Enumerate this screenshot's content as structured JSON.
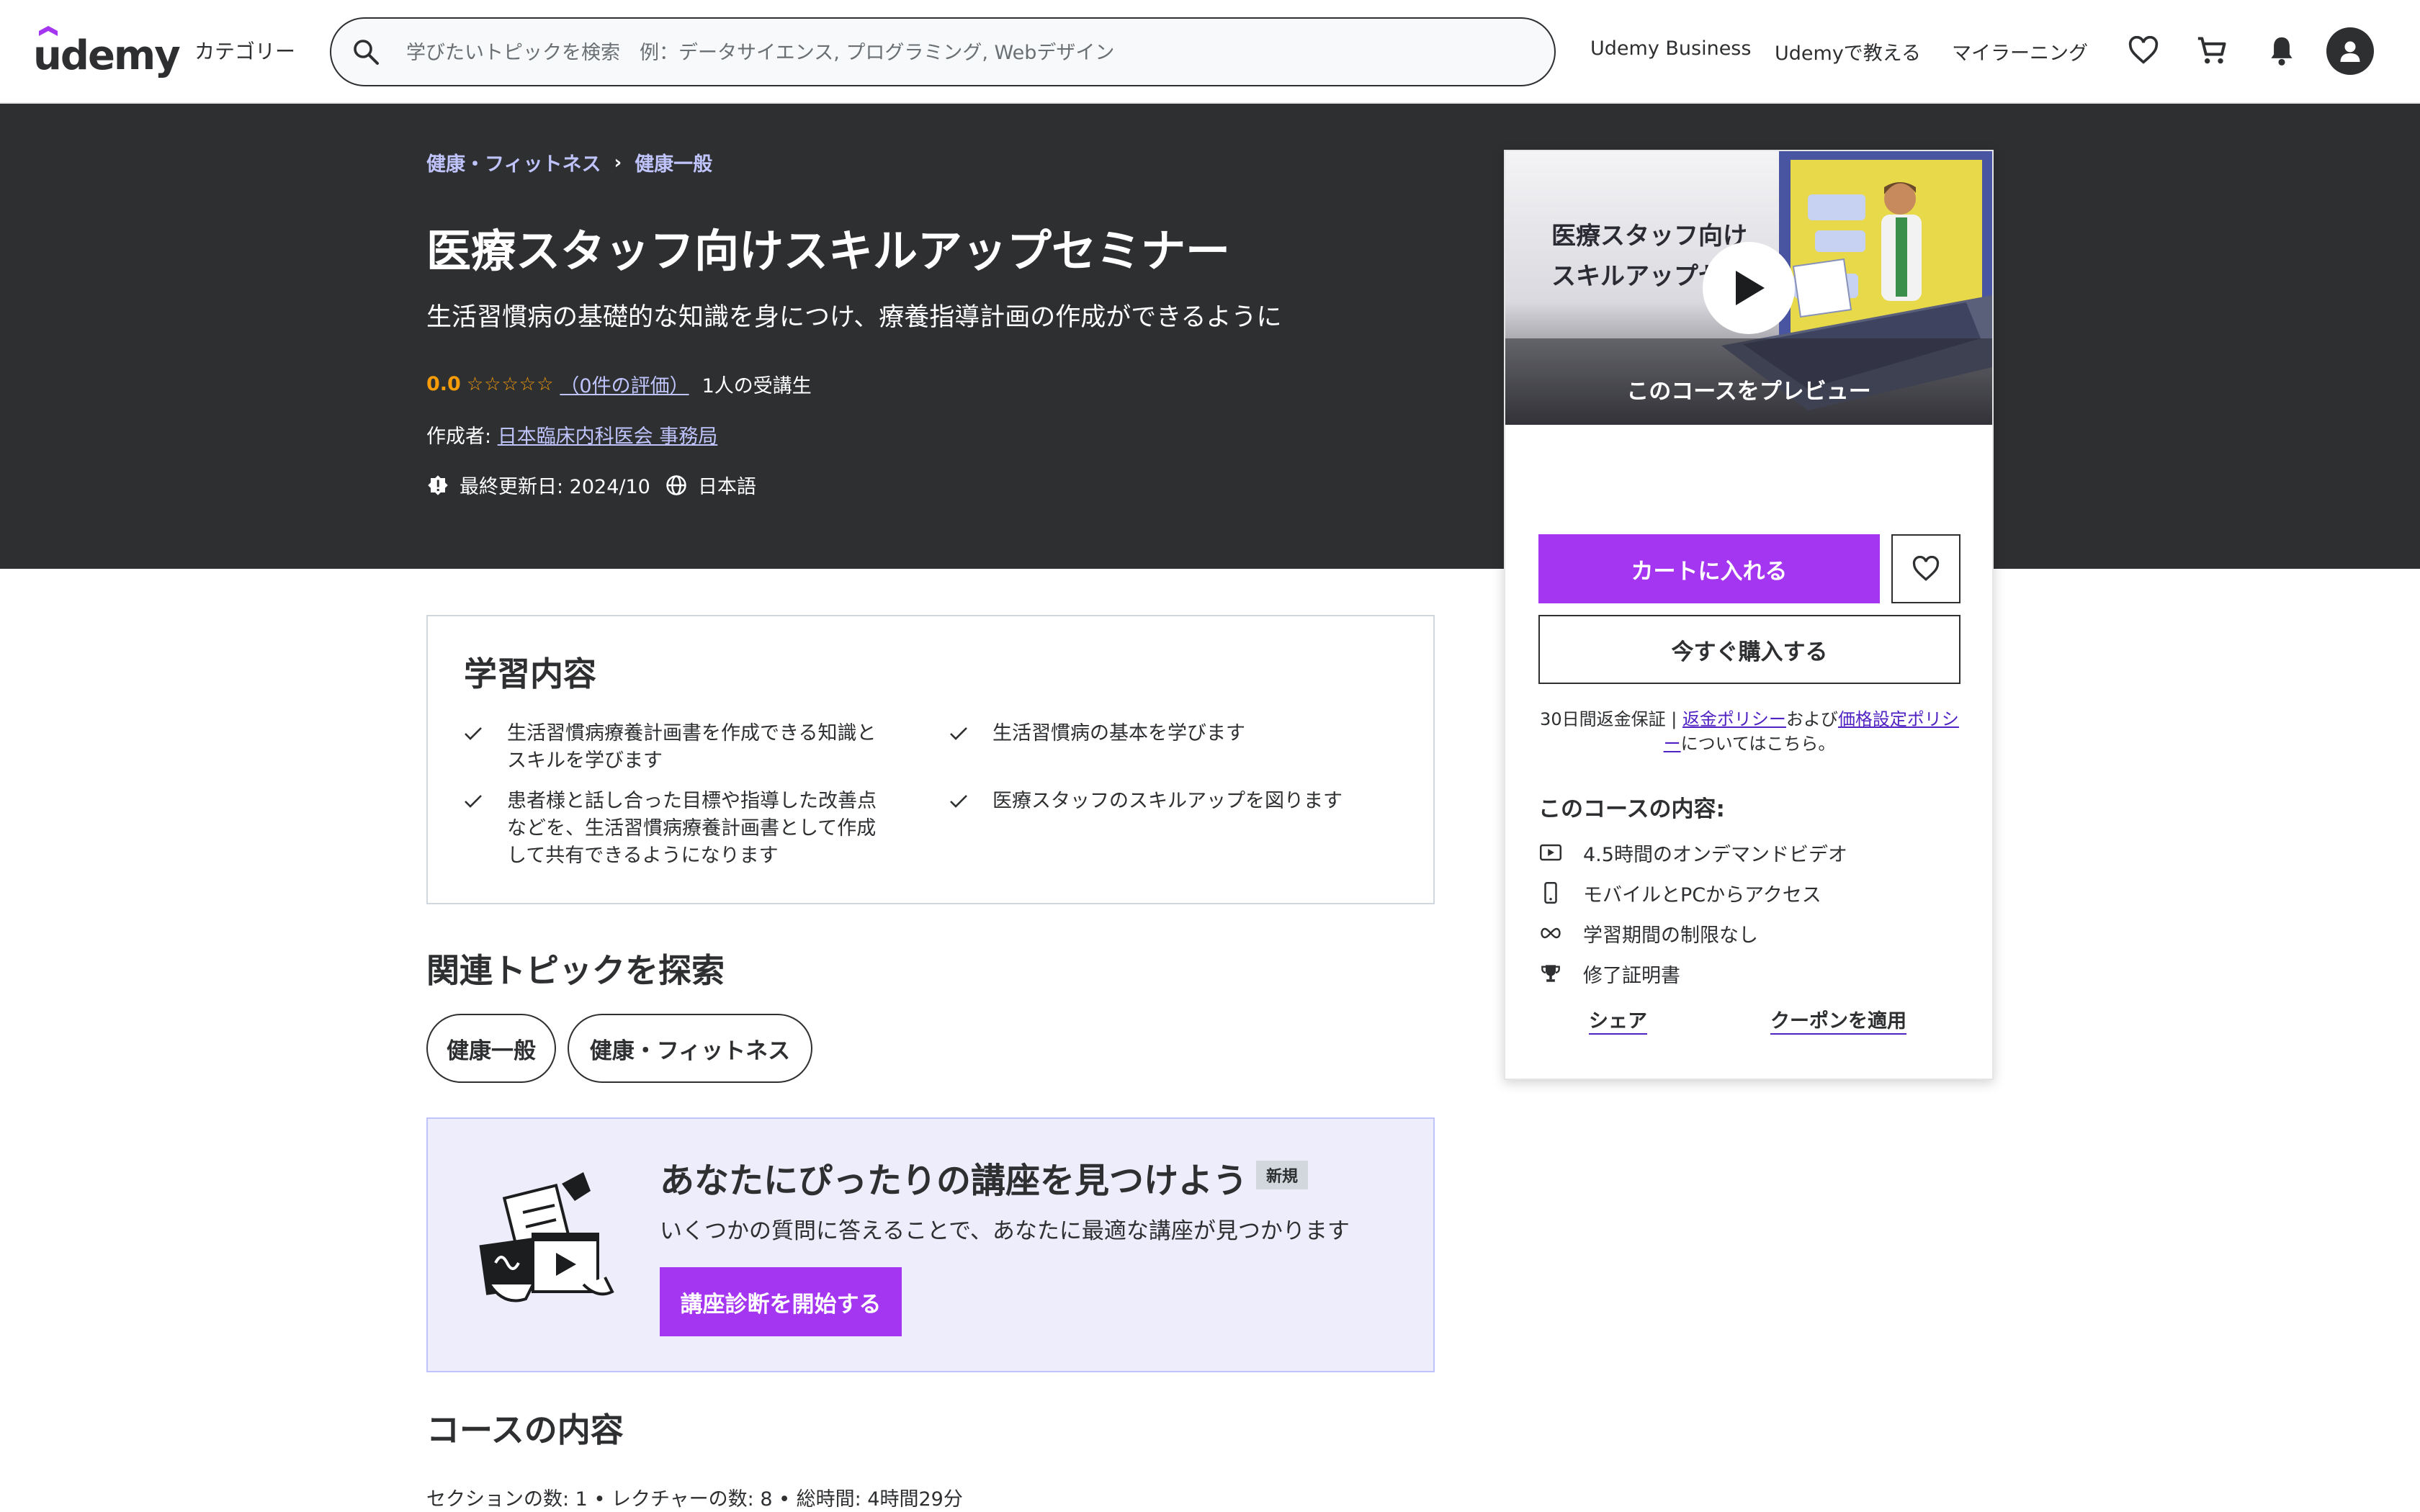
{
  "header": {
    "logo_text": "udemy",
    "categories_label": "カテゴリー",
    "search_placeholder": "学びたいトピックを検索　例：データサイエンス, プログラミング, Webデザイン",
    "nav": {
      "business": "Udemy Business",
      "teach": "Udemyで教える",
      "my_learning": "マイラーニング"
    }
  },
  "course": {
    "breadcrumb": [
      "健康・フィットネス",
      "健康一般"
    ],
    "title": "医療スタッフ向けスキルアップセミナー",
    "subtitle": "生活習慣病の基礎的な知識を身につけ、療養指導計画の作成ができるように",
    "rating_value": "0.0",
    "stars": "☆☆☆☆☆",
    "rating_count": "（0件の評価）",
    "students": "1人の受講生",
    "author_label": "作成者: ",
    "author": "日本臨床内科医会 事務局",
    "last_updated": "最終更新日: 2024/10",
    "language": "日本語"
  },
  "sidebar": {
    "preview_line1": "医療スタッフ向け",
    "preview_line2": "スキルアップセ",
    "preview_label": "このコースをプレビュー",
    "add_to_cart": "カートに入れる",
    "buy_now": "今すぐ購入する",
    "guarantee_pre": "30日間返金保証 | ",
    "refund_link": "返金ポリシー",
    "guarantee_mid": "および",
    "pricing_link": "価格設定ポリシー",
    "guarantee_post": "についてはこちら。",
    "includes_title": "このコースの内容:",
    "includes": [
      {
        "icon": "video-icon",
        "text": "4.5時間のオンデマンドビデオ"
      },
      {
        "icon": "mobile-icon",
        "text": "モバイルとPCからアクセス"
      },
      {
        "icon": "infinity-icon",
        "text": "学習期間の制限なし"
      },
      {
        "icon": "trophy-icon",
        "text": "修了証明書"
      }
    ],
    "share": "シェア",
    "coupon": "クーポンを適用"
  },
  "learn": {
    "title": "学習内容",
    "items": [
      "生活習慣病療養計画書を作成できる知識とスキルを学びます",
      "生活習慣病の基本を学びます",
      "患者様と話し合った目標や指導した改善点などを、生活習慣病療養計画書として作成して共有できるようになります",
      "医療スタッフのスキルアップを図ります"
    ]
  },
  "topics": {
    "title": "関連トピックを探索",
    "chips": [
      "健康一般",
      "健康・フィットネス"
    ]
  },
  "finder": {
    "title": "あなたにぴったりの講座を見つけよう",
    "badge": "新規",
    "description": "いくつかの質問に答えることで、あなたに最適な講座が見つかります",
    "button": "講座診断を開始する"
  },
  "content": {
    "title": "コースの内容",
    "meta": "セクションの数: 1 • レクチャーの数: 8 • 総時間: 4時間29分"
  },
  "colors": {
    "brand_purple": "#a435f0",
    "dark_band": "#2d2f31",
    "link_lavender": "#c0c4fc",
    "rating_orange": "#f69c08"
  }
}
